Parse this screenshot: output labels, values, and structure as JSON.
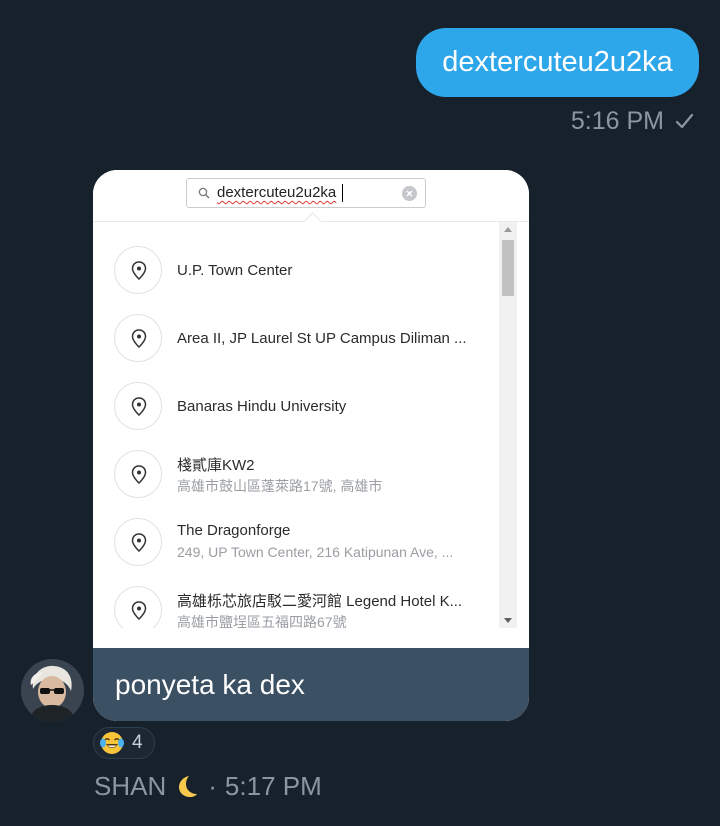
{
  "outgoing": {
    "text": "dextercuteu2u2ka",
    "time": "5:16 PM",
    "status_icon": "check-icon"
  },
  "card": {
    "search": {
      "value": "dextercuteu2u2ka",
      "icon": "search-icon",
      "clear_icon": "clear-icon"
    },
    "places": [
      {
        "title": "U.P. Town Center",
        "subtitle": ""
      },
      {
        "title": "Area II, JP Laurel St UP Campus Diliman ...",
        "subtitle": ""
      },
      {
        "title": "Banaras Hindu University",
        "subtitle": ""
      },
      {
        "title": "棧貳庫KW2",
        "subtitle": "高雄市鼓山區蓬萊路17號, 高雄市"
      },
      {
        "title": "The Dragonforge",
        "subtitle": "249, UP Town Center, 216 Katipunan Ave, ..."
      },
      {
        "title": "高雄栎芯旅店駁二愛河館 Legend Hotel K...",
        "subtitle": "高雄市鹽埕區五福四路67號"
      }
    ],
    "caption": "ponyeta ka dex"
  },
  "reaction": {
    "emoji": "face-with-tears-of-joy",
    "count": "4"
  },
  "sender": {
    "name": "SHAN",
    "emoji_icon": "crescent-moon-icon",
    "separator": "·",
    "time": "5:17 PM"
  },
  "colors": {
    "background": "#17212b",
    "outgoing_bubble": "#2ea6ea",
    "caption_bg": "#3c5064",
    "meta_text": "#8a96a3"
  }
}
